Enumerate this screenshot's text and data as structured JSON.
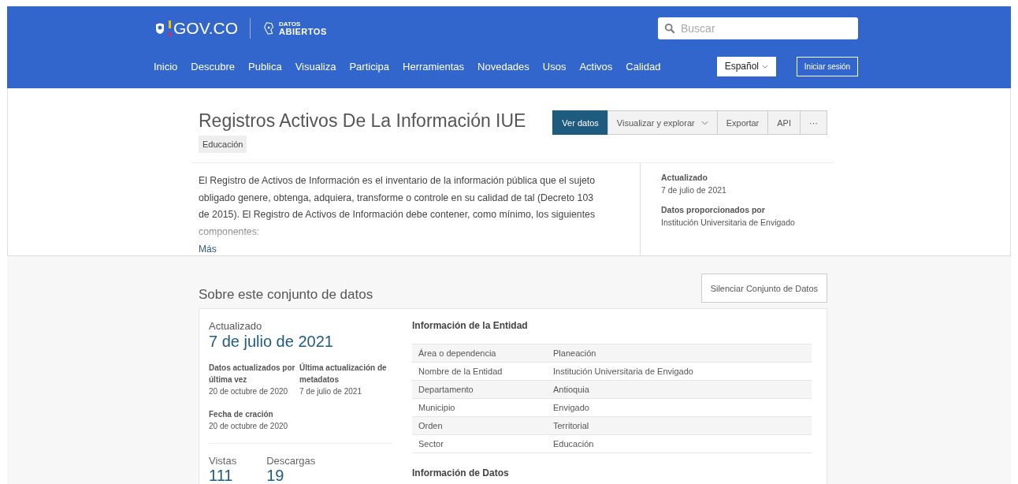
{
  "header": {
    "logo": "GOV.CO",
    "brand_small": "DATOS",
    "brand_large": "ABIERTOS",
    "search": {
      "placeholder": "Buscar"
    },
    "nav": [
      "Inicio",
      "Descubre",
      "Publica",
      "Visualiza",
      "Participa",
      "Herramientas",
      "Novedades",
      "Usos",
      "Activos",
      "Calidad"
    ],
    "language": "Español",
    "login": "Iniciar sesión"
  },
  "dataset": {
    "title": "Registros Activos De La Información IUE",
    "tag": "Educación",
    "actions": [
      {
        "label": "Ver datos",
        "kind": "primary"
      },
      {
        "label": "Visualizar y explorar",
        "kind": "dropdown"
      },
      {
        "label": "Exportar",
        "kind": "plain"
      },
      {
        "label": "API",
        "kind": "plain"
      },
      {
        "label": "···",
        "kind": "plain"
      }
    ],
    "description": "El Registro de Activos de Información es el inventario de la información pública que el sujeto obligado genere, obtenga, adquiera, transforme o controle en su calidad de tal (Decreto 103 de 2015). El Registro de Activos de Información debe contener, como mínimo, los siguientes componentes:",
    "more": "Más",
    "meta": [
      {
        "label": "Actualizado",
        "value": "7 de julio de 2021"
      },
      {
        "label": "Datos proporcionados por",
        "value": "Institución Universitaria de Envigado"
      }
    ]
  },
  "about": {
    "title": "Sobre este conjunto de datos",
    "mute_button": "Silenciar Conjunto de Datos",
    "updated_label": "Actualizado",
    "updated_value": "7 de julio de 2021",
    "dates": [
      {
        "label": "Datos actualizados por última vez",
        "value": "20 de octubre de 2020"
      },
      {
        "label": "Última actualización de metadatos",
        "value": "7 de julio de 2021"
      },
      {
        "label": "Fecha de cración",
        "value": "20 de octubre de 2020"
      }
    ],
    "stats": [
      {
        "label": "Vistas",
        "value": "111"
      },
      {
        "label": "Descargas",
        "value": "19"
      }
    ],
    "entity_title": "Información de la Entidad",
    "entity_rows": [
      {
        "key": "Área o dependencia",
        "value": "Planeación"
      },
      {
        "key": "Nombre de la Entidad",
        "value": "Institución Universitaria de Envigado"
      },
      {
        "key": "Departamento",
        "value": "Antioquia"
      },
      {
        "key": "Municipio",
        "value": "Envigado"
      },
      {
        "key": "Orden",
        "value": "Territorial"
      },
      {
        "key": "Sector",
        "value": "Educación"
      }
    ],
    "data_title": "Información de Datos"
  }
}
